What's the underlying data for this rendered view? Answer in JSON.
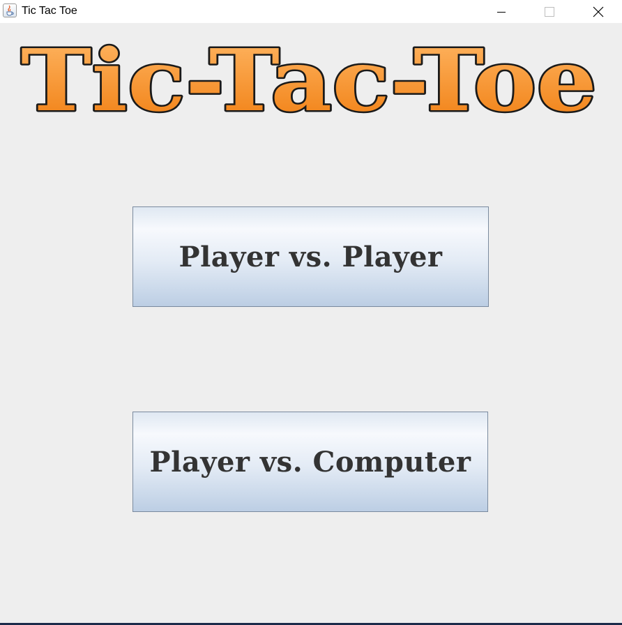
{
  "window": {
    "title": "Tic Tac Toe",
    "icon": "java-cup-icon",
    "controls": [
      "minimize-icon",
      "maximize-icon",
      "close-icon"
    ]
  },
  "logo": {
    "text": "Tic-Tac-Toe",
    "fill_top": "#ffb866",
    "fill_bottom": "#f07d10",
    "outline": "#1a1a1a"
  },
  "buttons": {
    "player_vs_player": "Player vs. Player",
    "player_vs_computer": "Player vs. Computer"
  },
  "colors": {
    "background": "#eeeeee",
    "button_text": "#333333",
    "button_border": "#7a8a9e"
  }
}
